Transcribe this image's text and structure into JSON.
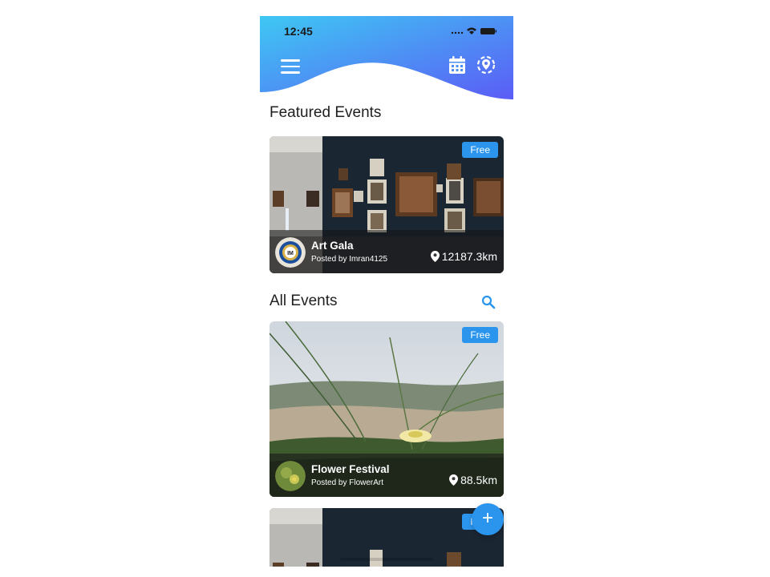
{
  "status_bar": {
    "time": "12:45"
  },
  "header": {
    "gradient_start": "#3ec8f3",
    "gradient_end": "#5b5cf6",
    "menu_icon": "hamburger-menu-icon",
    "calendar_icon": "calendar-icon",
    "location_icon": "location-pin-icon"
  },
  "featured": {
    "title": "Featured Events",
    "card": {
      "badge": "Free",
      "name": "Art Gala",
      "posted_by": "Posted by Imran4125",
      "distance": "12187.3km",
      "avatar_icon": "club-logo-avatar",
      "image": "art-gallery-photo"
    }
  },
  "all_events": {
    "title": "All Events",
    "search_icon": "search-icon",
    "cards": [
      {
        "badge": "Free",
        "name": "Flower Festival",
        "posted_by": "Posted by FlowerArt",
        "distance": "88.5km",
        "avatar_icon": "flower-avatar",
        "image": "flower-dune-photo"
      },
      {
        "badge": "Free",
        "image": "art-gallery-photo"
      }
    ]
  },
  "fab": {
    "label": "+"
  },
  "colors": {
    "accent": "#2b95ee",
    "text": "#1f1f1f"
  }
}
